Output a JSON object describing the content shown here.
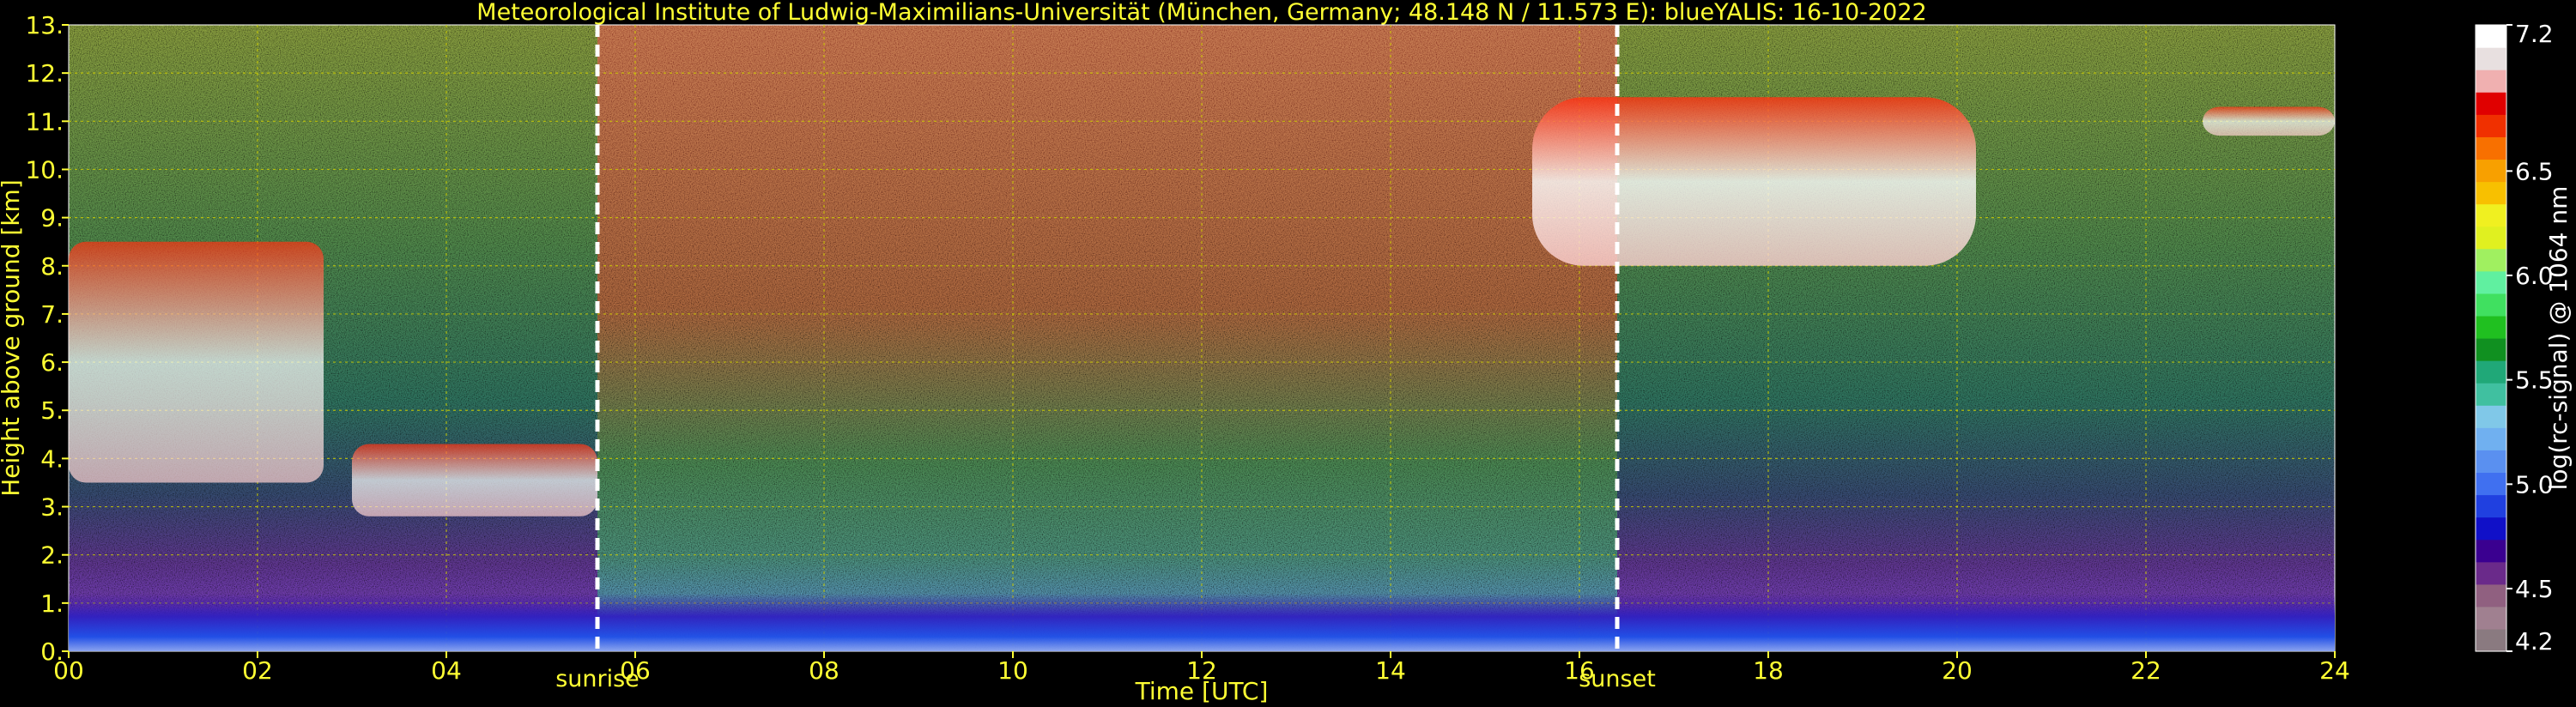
{
  "chart_data": {
    "type": "heatmap",
    "title": "Meteorological Institute of Ludwig-Maximilians-Universität (München, Germany; 48.148 N / 11.573 E):     blueYALIS: 16-10-2022",
    "xlabel": "Time [UTC]",
    "ylabel": "Height above ground [km]",
    "xlim": [
      0,
      24
    ],
    "ylim": [
      0,
      13
    ],
    "x_ticks": [
      "00",
      "02",
      "04",
      "06",
      "08",
      "10",
      "12",
      "14",
      "16",
      "18",
      "20",
      "22",
      "24"
    ],
    "x_tick_values": [
      0,
      2,
      4,
      6,
      8,
      10,
      12,
      14,
      16,
      18,
      20,
      22,
      24
    ],
    "y_ticks": [
      "0.",
      "1.",
      "2.",
      "3.",
      "4.",
      "5.",
      "6.",
      "7.",
      "8.",
      "9.",
      "10.",
      "11.",
      "12.",
      "13."
    ],
    "y_tick_values": [
      0,
      1,
      2,
      3,
      4,
      5,
      6,
      7,
      8,
      9,
      10,
      11,
      12,
      13
    ],
    "grid": true,
    "events": [
      {
        "label": "sunrise",
        "time": 5.6
      },
      {
        "label": "sunset",
        "time": 16.4
      }
    ],
    "colorbar": {
      "label": "log(rc-signal) @ 1064 nm",
      "range": [
        4.2,
        7.2
      ],
      "ticks": [
        "4.2",
        "4.5",
        "5.0",
        "5.5",
        "6.0",
        "6.5",
        "7.2"
      ],
      "tick_values": [
        4.2,
        4.5,
        5.0,
        5.5,
        6.0,
        6.5,
        7.2
      ],
      "colors": [
        "#8a7a80",
        "#a08090",
        "#906080",
        "#6a2a8a",
        "#3a0090",
        "#1010c8",
        "#2040e0",
        "#4070f0",
        "#5a90f0",
        "#70b0f0",
        "#80c8e8",
        "#40c0a0",
        "#20a878",
        "#109020",
        "#20c020",
        "#40e060",
        "#60f0a0",
        "#a0f060",
        "#e0f020",
        "#f0f020",
        "#f8c000",
        "#f8a000",
        "#f87000",
        "#f03000",
        "#e00000",
        "#f0b0b0",
        "#e8e0e0",
        "#ffffff"
      ]
    },
    "features": [
      {
        "kind": "cirrus",
        "t_start": 15.5,
        "t_end": 20.2,
        "h_bottom": 8.0,
        "h_top": 11.5
      },
      {
        "kind": "cloud",
        "t_start": 0.0,
        "t_end": 2.7,
        "h_bottom": 3.5,
        "h_top": 8.5
      },
      {
        "kind": "cloud",
        "t_start": 3.0,
        "t_end": 5.6,
        "h_bottom": 2.8,
        "h_top": 4.3
      },
      {
        "kind": "cloud",
        "t_start": 22.6,
        "t_end": 24.0,
        "h_bottom": 10.7,
        "h_top": 11.3
      },
      {
        "kind": "boundary-layer",
        "t_start": 0.0,
        "t_end": 24.0,
        "h_bottom": 0.0,
        "h_top": 1.2
      }
    ]
  }
}
